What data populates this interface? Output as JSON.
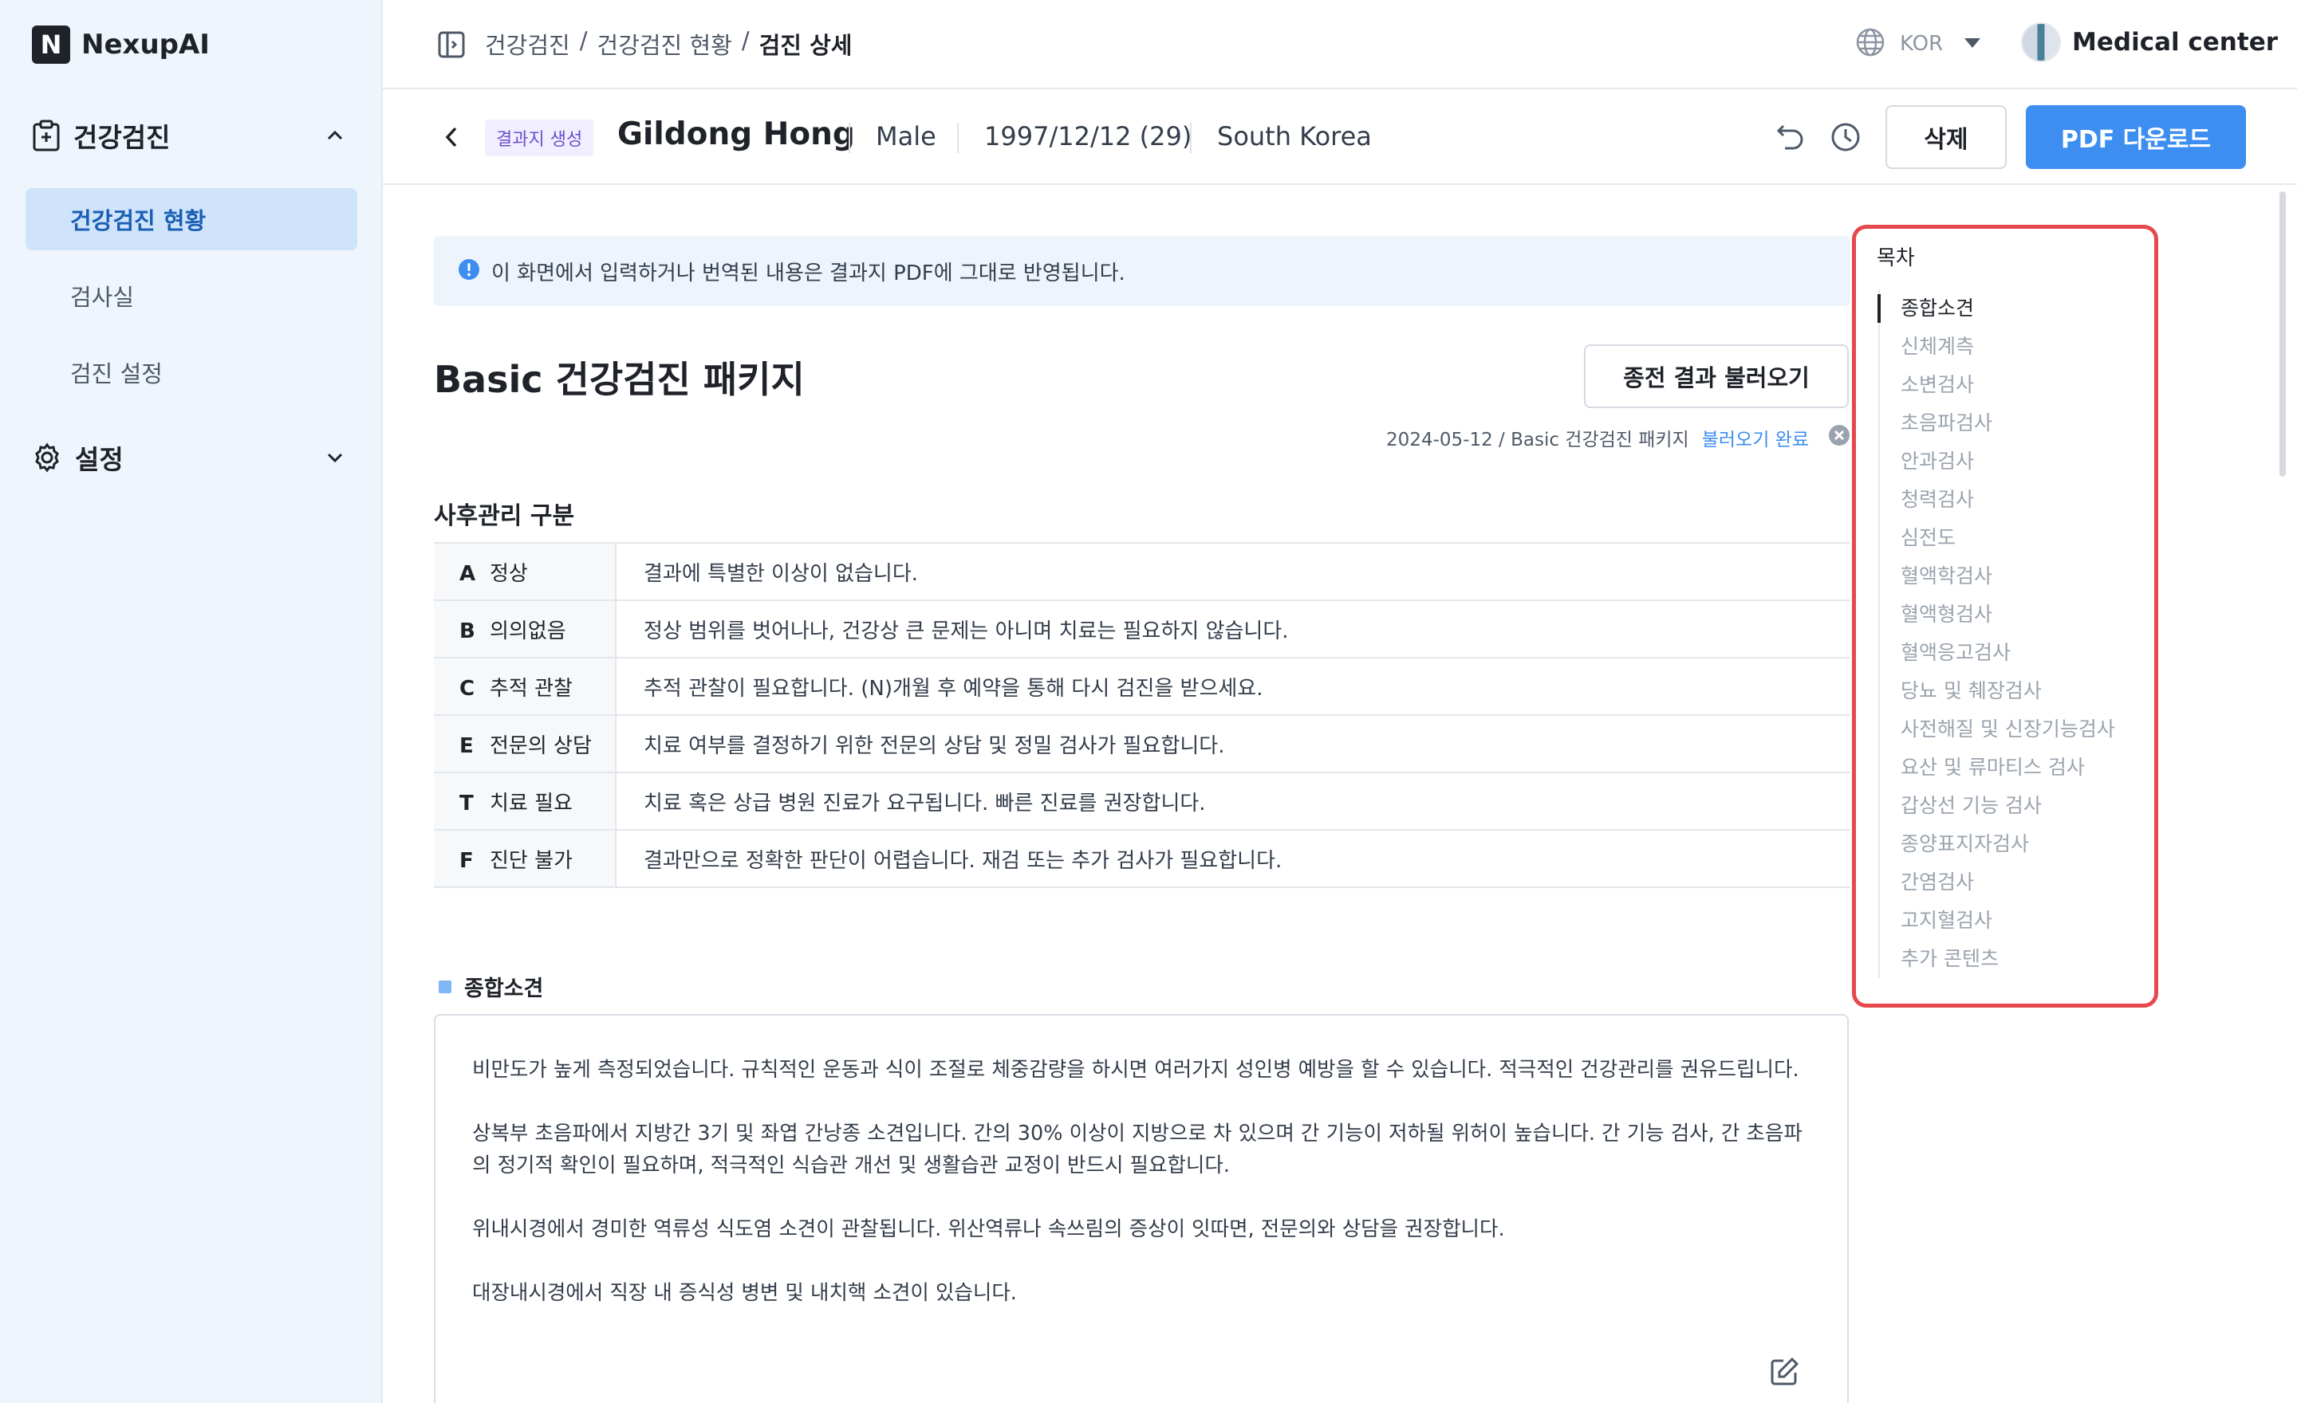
{
  "app": {
    "logo_letter": "N",
    "name": "NexupAI"
  },
  "sidebar": {
    "group_health": "건강검진",
    "items": [
      "건강검진 현황",
      "검사실",
      "검진 설정"
    ],
    "group_settings": "설정"
  },
  "topbar": {
    "breadcrumb": [
      "건강검진",
      "건강검진 현황",
      "검진 상세"
    ],
    "breadcrumb_sep": "/",
    "language": "KOR",
    "org_name": "Medical center"
  },
  "patient": {
    "status_badge": "결과지 생성",
    "name": "Gildong Hong",
    "gender": "Male",
    "birth": "1997/12/12 (29)",
    "country": "South Korea",
    "delete_label": "삭제",
    "pdf_label": "PDF 다운로드"
  },
  "main": {
    "notice": "이 화면에서 입력하거나 번역된 내용은 결과지 PDF에 그대로 반영됩니다.",
    "package_title": "Basic 건강검진 패키지",
    "load_prev_label": "종전 결과 불러오기",
    "load_info": "2024-05-12 / Basic 건강검진 패키지",
    "load_done": "불러오기 완료",
    "grade_section_title": "사후관리 구분",
    "grades": [
      {
        "code": "A",
        "name": "정상",
        "desc": "결과에 특별한 이상이 없습니다."
      },
      {
        "code": "B",
        "name": "의의없음",
        "desc": "정상 범위를 벗어나나, 건강상 큰 문제는 아니며 치료는 필요하지 않습니다."
      },
      {
        "code": "C",
        "name": "추적 관찰",
        "desc": "추적 관찰이 필요합니다. (N)개월 후 예약을 통해 다시 검진을 받으세요."
      },
      {
        "code": "E",
        "name": "전문의 상담",
        "desc": "치료 여부를 결정하기 위한 전문의 상담 및 정밀 검사가 필요합니다."
      },
      {
        "code": "T",
        "name": "치료 필요",
        "desc": "치료 혹은 상급 병원 진료가 요구됩니다. 빠른 진료를 권장합니다."
      },
      {
        "code": "F",
        "name": "진단 불가",
        "desc": "결과만으로 정확한 판단이 어렵습니다. 재검 또는 추가 검사가 필요합니다."
      }
    ],
    "summary_title": "종합소견",
    "summary_paragraphs": [
      "비만도가 높게 측정되었습니다. 규칙적인 운동과 식이 조절로 체중감량을 하시면 여러가지 성인병 예방을 할 수 있습니다. 적극적인 건강관리를 권유드립니다.",
      "상복부 초음파에서 지방간 3기 및 좌엽 간낭종 소견입니다. 간의 30% 이상이 지방으로 차 있으며 간 기능이 저하될 위허이 높습니다. 간 기능 검사, 간 초음파의 정기적 확인이 필요하며, 적극적인 식습관 개선 및 생활습관 교정이 반드시 필요합니다.",
      "위내시경에서 경미한 역류성 식도염 소견이 관찰됩니다. 위산역류나 속쓰림의 증상이 잇따면, 전문의와 상담을 권장합니다.",
      "대장내시경에서 직장 내 증식성 병변 및 내치핵 소견이 있습니다."
    ]
  },
  "toc": {
    "title": "목차",
    "items": [
      "종합소견",
      "신체계측",
      "소변검사",
      "초음파검사",
      "안과검사",
      "청력검사",
      "심전도",
      "혈액학검사",
      "혈액형검사",
      "혈액응고검사",
      "당뇨 및 췌장검사",
      "사전해질 및 신장기능검사",
      "요산 및 류마티스 검사",
      "갑상선 기능 검사",
      "종양표지자검사",
      "간염검사",
      "고지혈검사",
      "추가 콘텐츠"
    ]
  },
  "colors": {
    "accent": "#3d8ef0",
    "sidebar_bg": "#eff5fc",
    "active_bg": "#cfe4fb",
    "highlight": "#e5484d"
  },
  "icons": [
    "panel-toggle-icon",
    "globe-icon",
    "caret-down-icon",
    "back-arrow-icon",
    "undo-icon",
    "history-clock-icon",
    "info-icon",
    "close-circle-icon",
    "edit-icon",
    "clipboard-icon",
    "gear-icon",
    "chevron-up-icon",
    "chevron-down-icon"
  ]
}
